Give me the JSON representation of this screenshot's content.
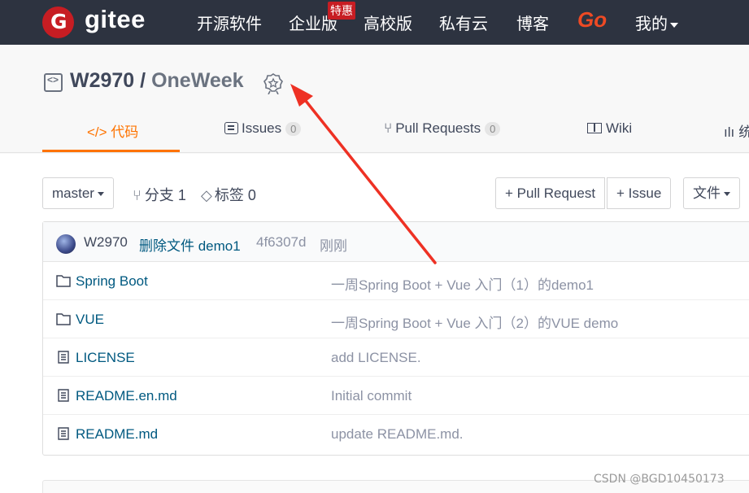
{
  "brand": {
    "logo_text": "gitee",
    "logo_letter": "G"
  },
  "nav": {
    "items": [
      "开源软件",
      "企业版",
      "高校版",
      "私有云",
      "博客"
    ],
    "hot_badge": "特惠",
    "go_label": "Go",
    "mine_label": "我的"
  },
  "repo": {
    "owner": "W2970",
    "separator": "/",
    "name": "OneWeek"
  },
  "tabs": [
    {
      "label": "</> 代码"
    },
    {
      "label": "Issues",
      "count": "0"
    },
    {
      "label": "Pull Requests",
      "count": "0"
    },
    {
      "label": "Wiki"
    },
    {
      "label": "统"
    }
  ],
  "toolbar": {
    "branch": "master",
    "branches_label": "分支 1",
    "tags_label": "标签 0",
    "new_pr": "+ Pull Request",
    "new_issue": "+ Issue",
    "files_menu": "文件"
  },
  "last_commit": {
    "author": "W2970",
    "message": "删除文件 demo1",
    "sha": "4f6307d",
    "time": "刚刚"
  },
  "files": [
    {
      "type": "folder",
      "name": "Spring Boot",
      "commit": "一周Spring Boot + Vue 入门（1）的demo1"
    },
    {
      "type": "folder",
      "name": "VUE",
      "commit": "一周Spring Boot + Vue 入门（2）的VUE demo"
    },
    {
      "type": "file",
      "name": "LICENSE",
      "commit": "add LICENSE."
    },
    {
      "type": "file",
      "name": "README.en.md",
      "commit": "Initial commit"
    },
    {
      "type": "file",
      "name": "README.md",
      "commit": "update README.md."
    }
  ],
  "watermark": "CSDN @BGD10450173",
  "colors": {
    "nav_bg": "#2d3340",
    "brand_red": "#c71d23",
    "accent_orange": "#fe7300",
    "link_blue": "#005980",
    "annotation_red": "#ee3124"
  }
}
